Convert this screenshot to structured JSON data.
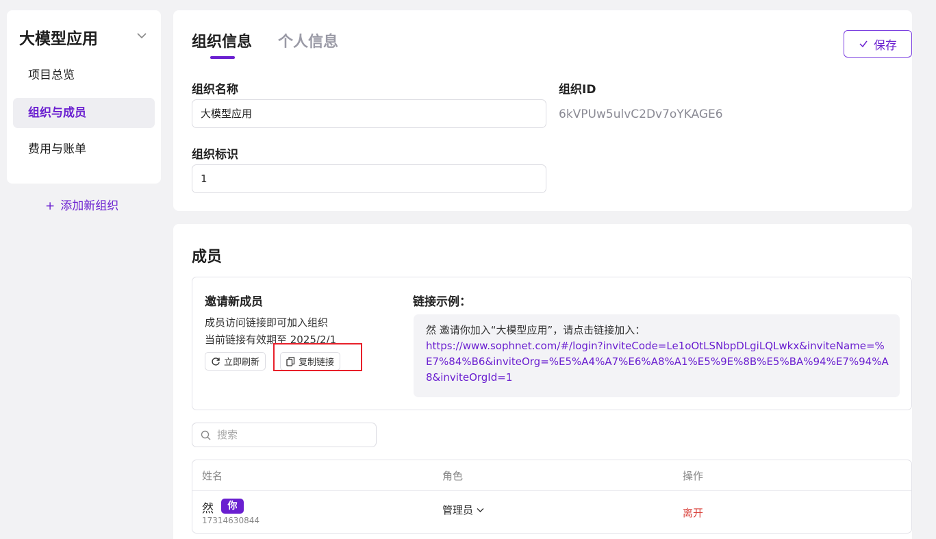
{
  "sidebar": {
    "org_name": "大模型应用",
    "items": [
      {
        "label": "项目总览"
      },
      {
        "label": "组织与成员"
      },
      {
        "label": "费用与账单"
      }
    ],
    "add_org_label": "添加新组织"
  },
  "tabs": [
    {
      "label": "组织信息"
    },
    {
      "label": "个人信息"
    }
  ],
  "save_label": "保存",
  "org_form": {
    "name_label": "组织名称",
    "name_value": "大模型应用",
    "id_label": "组织ID",
    "id_value": "6kVPUw5ulvC2Dv7oYKAGE6",
    "tag_label": "组织标识",
    "tag_value": "1"
  },
  "members": {
    "title": "成员",
    "invite": {
      "title": "邀请新成员",
      "line1": "成员访问链接即可加入组织",
      "line2": "当前链接有效期至 2025/2/1",
      "refresh_label": "立即刷新",
      "copy_label": "复制链接",
      "example_title": "链接示例：",
      "example_text": "然 邀请你加入“大模型应用”，请点击链接加入：",
      "example_link": "https://www.sophnet.com/#/login?inviteCode=Le1oOtLSNbpDLgiLQLwkx&inviteName=%E7%84%B6&inviteOrg=%E5%A4%A7%E6%A8%A1%E5%9E%8B%E5%BA%94%E7%94%A8&inviteOrgId=1"
    },
    "search_placeholder": "搜索",
    "table": {
      "headers": [
        "姓名",
        "角色",
        "操作"
      ],
      "rows": [
        {
          "name": "然",
          "badge": "你",
          "phone": "17314630844",
          "role": "管理员",
          "action": "离开"
        }
      ]
    }
  },
  "colors": {
    "accent": "#6a1fd0",
    "danger": "#d9403a",
    "highlight": "#e8202a"
  }
}
